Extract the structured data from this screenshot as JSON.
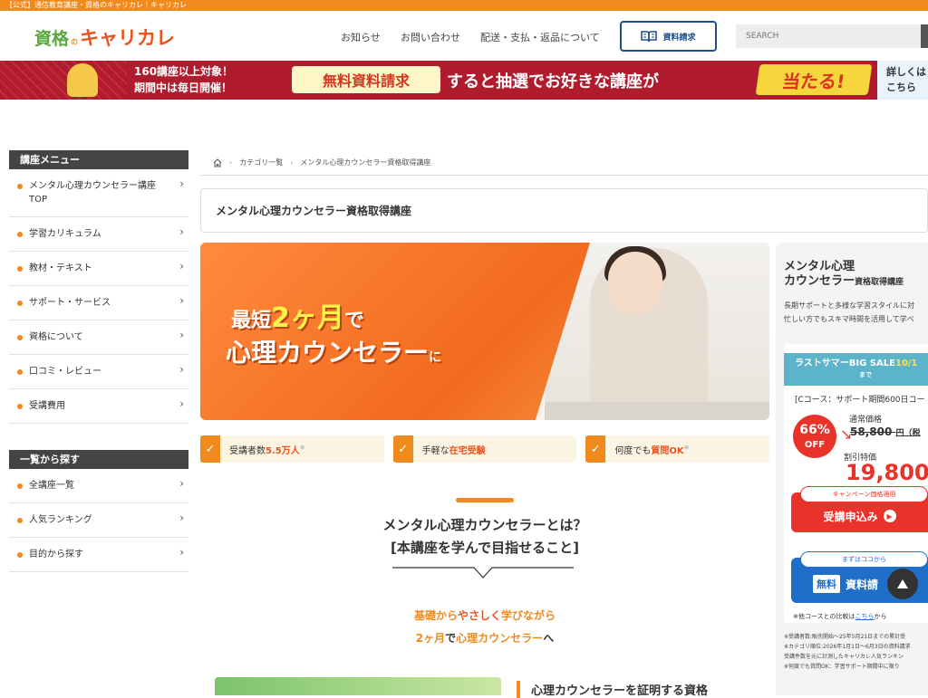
{
  "top_strip": "【公式】通信教育講座・資格のキャリカレ｜キャリカレ",
  "logo": {
    "part1": "資格",
    "part2": "の",
    "part3": "キャリカレ"
  },
  "nav": [
    "お知らせ",
    "お問い合わせ",
    "配送・支払・返品について"
  ],
  "doc_button": "資料請求",
  "search": {
    "placeholder": "SEARCH"
  },
  "banner": {
    "line1": "160講座以上対象！",
    "line2": "期間中は毎日開催！",
    "pill": "無料資料請求",
    "middle": "すると抽選でお好きな講座が",
    "tail": "当たる!",
    "side_line1": "詳しくは",
    "side_line2": "こちら"
  },
  "sidebar": {
    "menu_title": "講座メニュー",
    "menu_items": [
      "メンタル心理カウンセラー講座TOP",
      "学習カリキュラム",
      "教材・テキスト",
      "サポート・サービス",
      "資格について",
      "口コミ・レビュー",
      "受講費用"
    ],
    "list_title": "一覧から探す",
    "list_items": [
      "全講座一覧",
      "人気ランキング",
      "目的から探す"
    ]
  },
  "breadcrumb": {
    "cat": "カテゴリ一覧",
    "current": "メンタル心理カウンセラー資格取得講座"
  },
  "page_title": "メンタル心理カウンセラー資格取得講座",
  "hero": {
    "t1a": "最短",
    "t1b": "2ヶ月",
    "t1c": "で",
    "t2": "心理カウンセラー",
    "t2b": "に"
  },
  "features": [
    {
      "pre": "受講者数",
      "hl": "5.5万人",
      "mark": "※",
      "post": ""
    },
    {
      "pre": "手軽な",
      "hl": "在宅受験",
      "mark": "",
      "post": ""
    },
    {
      "pre": "何度でも",
      "hl": "質問OK",
      "mark": "※",
      "post": ""
    }
  ],
  "section": {
    "h2_line1": "メンタル心理カウンセラーとは？",
    "h2_line2": "[本講座を学んで目指せること]",
    "lead_line1_a": "基礎から",
    "lead_line1_b": "やさしく",
    "lead_line1_c": "学びながら",
    "lead_line2_a": "2ヶ月",
    "lead_line2_b": "で",
    "lead_line2_c": "心理カウンセラー",
    "lead_line2_d": "へ",
    "subheading": "心理カウンセラーを証明する資格"
  },
  "card": {
    "title_line1": "メンタル心理",
    "title_line2": "カウンセラー",
    "title_suffix": "資格取得講座",
    "desc_line1": "長期サポートと多様な学習スタイルに対",
    "desc_line2": "忙しい方でもスキマ時間を活用して学べ",
    "sale_label": "ラストサマーBIG SALE",
    "sale_date": "10/1",
    "sale_sub": "まで",
    "course": "[Cコース：サポート期間600日コー",
    "badge_pct": "66%",
    "badge_off": "OFF",
    "regular_label": "通常価格",
    "regular_price": "58,800",
    "regular_unit": "円（税",
    "discount_label": "割引特価",
    "discount_price": "19,800",
    "cta_tag": "キャンペーン価格適用",
    "cta_label": "受講申込み",
    "cta2_tag": "まずはココから",
    "cta2_free": "無料",
    "cta2_label": "資料請",
    "compare_pre": "※他コースとの比較は",
    "compare_link": "こちら",
    "compare_post": "から",
    "notes": [
      "※受講者数:販売開始～25年5月21日までの累計受",
      "※カテゴリ順位:2026年1月1日～6月3日の資料請求",
      "受講件数を元に計測したキャリカレ人気ランキン",
      "※何度でも質問OK：学習サポート期間中に限り"
    ]
  }
}
